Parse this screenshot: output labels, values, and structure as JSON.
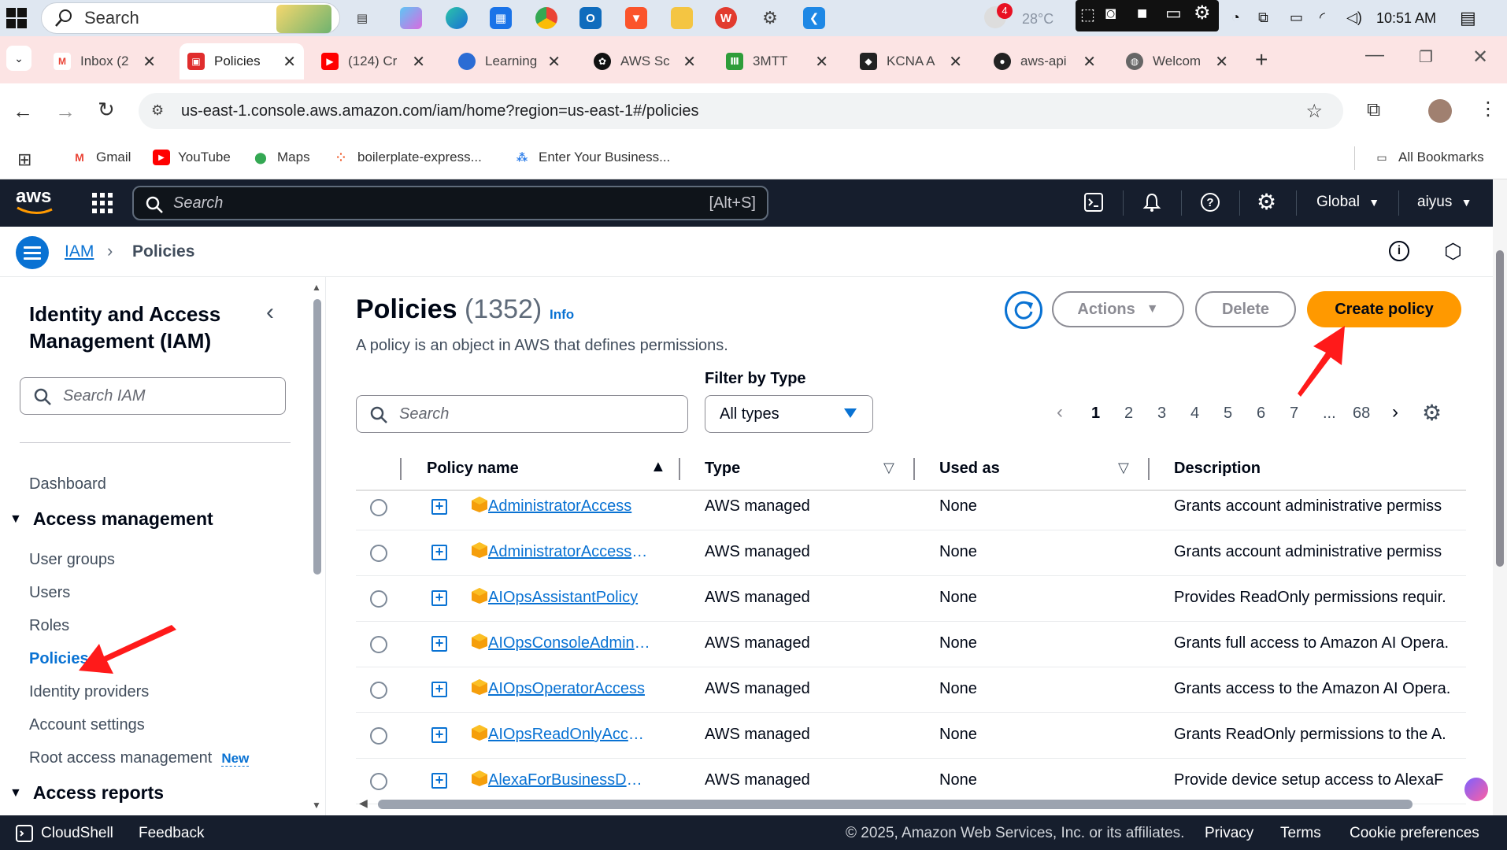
{
  "taskbar": {
    "search_placeholder": "Search",
    "weather_temp": "28°C",
    "notification_count": "4",
    "clock": "10:51 AM"
  },
  "browser": {
    "tabs": [
      {
        "label": "Inbox (2",
        "icon": "gmail-icon"
      },
      {
        "label": "Policies",
        "icon": "aws-icon"
      },
      {
        "label": "(124) Cr",
        "icon": "youtube-icon"
      },
      {
        "label": "Learning",
        "icon": "learning-icon"
      },
      {
        "label": "AWS Sc",
        "icon": "openai-icon"
      },
      {
        "label": "3MTT",
        "icon": "3mtt-icon"
      },
      {
        "label": "KCNA A",
        "icon": "kcna-icon"
      },
      {
        "label": "aws-api",
        "icon": "github-icon"
      },
      {
        "label": "Welcom",
        "icon": "globe-icon"
      }
    ],
    "url": "us-east-1.console.aws.amazon.com/iam/home?region=us-east-1#/policies",
    "bookmarks": [
      {
        "label": "Gmail",
        "icon": "gmail-icon"
      },
      {
        "label": "YouTube",
        "icon": "youtube-icon"
      },
      {
        "label": "Maps",
        "icon": "maps-icon"
      },
      {
        "label": "boilerplate-express...",
        "icon": "glitch-icon"
      },
      {
        "label": "Enter Your Business...",
        "icon": "business-icon"
      }
    ],
    "all_bookmarks": "All Bookmarks"
  },
  "aws": {
    "logo": "aws",
    "search_placeholder": "Search",
    "search_shortcut": "[Alt+S]",
    "region": "Global",
    "user": "aiyus"
  },
  "breadcrumb": {
    "root": "IAM",
    "current": "Policies"
  },
  "sidebar": {
    "title": "Identity and Access Management (IAM)",
    "search_placeholder": "Search IAM",
    "dashboard": "Dashboard",
    "access_management": "Access management",
    "items": [
      "User groups",
      "Users",
      "Roles",
      "Policies",
      "Identity providers",
      "Account settings",
      "Root access management"
    ],
    "new_badge": "New",
    "access_reports": "Access reports"
  },
  "main": {
    "title": "Policies",
    "count": "(1352)",
    "info": "Info",
    "description": "A policy is an object in AWS that defines permissions.",
    "actions_label": "Actions",
    "delete_label": "Delete",
    "create_label": "Create policy",
    "filter_label": "Filter by Type",
    "search_placeholder": "Search",
    "filter_value": "All types",
    "pages": [
      "1",
      "2",
      "3",
      "4",
      "5",
      "6",
      "7",
      "...",
      "68"
    ],
    "columns": [
      "Policy name",
      "Type",
      "Used as",
      "Description"
    ],
    "rows": [
      {
        "name": "AdministratorAccess",
        "type": "AWS managed",
        "used": "None",
        "desc": "Grants account administrative permiss"
      },
      {
        "name": "AdministratorAccess-Amplify",
        "type": "AWS managed",
        "used": "None",
        "desc": "Grants account administrative permiss"
      },
      {
        "name": "AIOpsAssistantPolicy",
        "type": "AWS managed",
        "used": "None",
        "desc": "Provides ReadOnly permissions requir."
      },
      {
        "name": "AIOpsConsoleAdminPolicy",
        "type": "AWS managed",
        "used": "None",
        "desc": "Grants full access to Amazon AI Opera."
      },
      {
        "name": "AIOpsOperatorAccess",
        "type": "AWS managed",
        "used": "None",
        "desc": "Grants access to the Amazon AI Opera."
      },
      {
        "name": "AIOpsReadOnlyAccess",
        "type": "AWS managed",
        "used": "None",
        "desc": "Grants ReadOnly permissions to the A."
      },
      {
        "name": "AlexaForBusinessDeviceSetup",
        "type": "AWS managed",
        "used": "None",
        "desc": "Provide device setup access to AlexaF"
      }
    ]
  },
  "footer": {
    "cloudshell": "CloudShell",
    "feedback": "Feedback",
    "copyright": "© 2025, Amazon Web Services, Inc. or its affiliates.",
    "privacy": "Privacy",
    "terms": "Terms",
    "cookies": "Cookie preferences"
  },
  "colors": {
    "aws_nav": "#161e2d",
    "link_blue": "#0972d3",
    "primary_orange": "#ff9900",
    "annotation_red": "#ff1a1a"
  }
}
